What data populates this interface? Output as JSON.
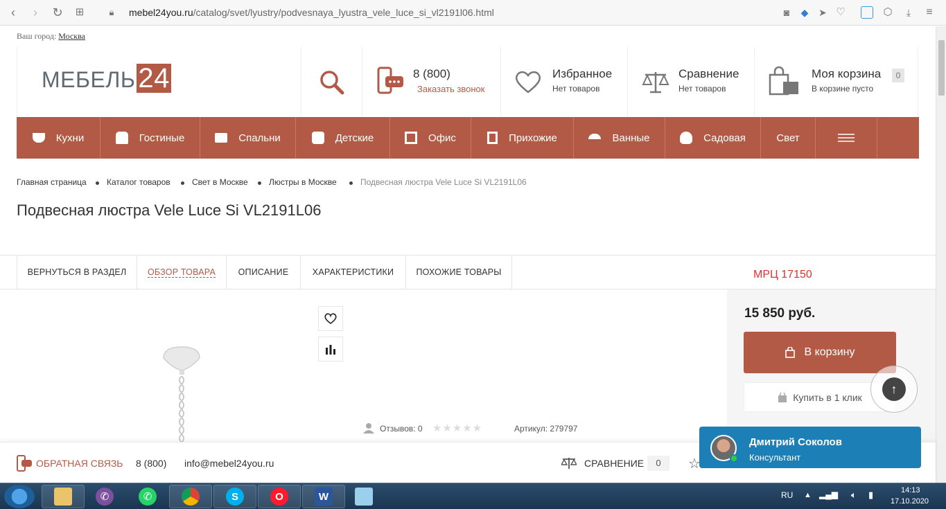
{
  "browser": {
    "url_host": "mebel24you.ru",
    "url_path": "/catalog/svet/lyustry/podvesnaya_lyustra_vele_luce_si_vl2191l06.html"
  },
  "header": {
    "city_label": "Ваш город:",
    "city_value": "Москва",
    "logo_text": "МЕБЕЛЬ",
    "logo_number": "24",
    "phone": "8 (800)",
    "callback": "Заказать звонок",
    "favorites_title": "Избранное",
    "favorites_sub": "Нет товаров",
    "compare_title": "Сравнение",
    "compare_sub": "Нет товаров",
    "cart_title": "Моя корзина",
    "cart_sub": "В корзине пусто",
    "cart_count": "0"
  },
  "catmenu": {
    "items": [
      "Кухни",
      "Гостиные",
      "Спальни",
      "Детские",
      "Офис",
      "Прихожие",
      "Ванные",
      "Садовая",
      "Свет"
    ]
  },
  "breadcrumbs": [
    "Главная страница",
    "Каталог товаров",
    "Свет в Москве",
    "Люстры в Москве",
    "Подвесная люстра Vele Luce Si VL2191L06"
  ],
  "product": {
    "title": "Подвесная люстра Vele Luce Si VL2191L06",
    "mrp": "МРЦ 17150",
    "price": "15 850 руб.",
    "cart_button": "В корзину",
    "oneclick_button": "Купить в 1 клик",
    "reviews": "Отзывов: 0",
    "rating": 0,
    "article": "Артикул: 279797"
  },
  "tabs": [
    "ВЕРНУТЬСЯ В РАЗДЕЛ",
    "ОБЗОР ТОВАРА",
    "ОПИСАНИЕ",
    "ХАРАКТЕРИСТИКИ",
    "ПОХОЖИЕ ТОВАРЫ"
  ],
  "footer": {
    "feedback": "ОБРАТНАЯ СВЯЗЬ",
    "phone": "8 (800)",
    "email": "info@mebel24you.ru",
    "compare": "СРАВНЕНИЕ",
    "compare_count": "0"
  },
  "chat": {
    "name": "Дмитрий Соколов",
    "role": "Консультант"
  },
  "taskbar": {
    "lang": "RU",
    "time": "14:13",
    "date": "17.10.2020"
  },
  "colors": {
    "brand": "#b35a47",
    "chat": "#1c7fb6",
    "mrp": "#e03131"
  }
}
